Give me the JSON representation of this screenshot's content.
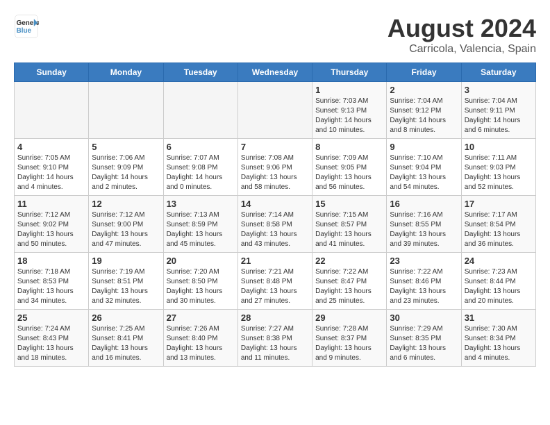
{
  "header": {
    "logo_line1": "General",
    "logo_line2": "Blue",
    "title": "August 2024",
    "subtitle": "Carricola, Valencia, Spain"
  },
  "weekdays": [
    "Sunday",
    "Monday",
    "Tuesday",
    "Wednesday",
    "Thursday",
    "Friday",
    "Saturday"
  ],
  "weeks": [
    [
      {
        "day": "",
        "info": ""
      },
      {
        "day": "",
        "info": ""
      },
      {
        "day": "",
        "info": ""
      },
      {
        "day": "",
        "info": ""
      },
      {
        "day": "1",
        "info": "Sunrise: 7:03 AM\nSunset: 9:13 PM\nDaylight: 14 hours\nand 10 minutes."
      },
      {
        "day": "2",
        "info": "Sunrise: 7:04 AM\nSunset: 9:12 PM\nDaylight: 14 hours\nand 8 minutes."
      },
      {
        "day": "3",
        "info": "Sunrise: 7:04 AM\nSunset: 9:11 PM\nDaylight: 14 hours\nand 6 minutes."
      }
    ],
    [
      {
        "day": "4",
        "info": "Sunrise: 7:05 AM\nSunset: 9:10 PM\nDaylight: 14 hours\nand 4 minutes."
      },
      {
        "day": "5",
        "info": "Sunrise: 7:06 AM\nSunset: 9:09 PM\nDaylight: 14 hours\nand 2 minutes."
      },
      {
        "day": "6",
        "info": "Sunrise: 7:07 AM\nSunset: 9:08 PM\nDaylight: 14 hours\nand 0 minutes."
      },
      {
        "day": "7",
        "info": "Sunrise: 7:08 AM\nSunset: 9:06 PM\nDaylight: 13 hours\nand 58 minutes."
      },
      {
        "day": "8",
        "info": "Sunrise: 7:09 AM\nSunset: 9:05 PM\nDaylight: 13 hours\nand 56 minutes."
      },
      {
        "day": "9",
        "info": "Sunrise: 7:10 AM\nSunset: 9:04 PM\nDaylight: 13 hours\nand 54 minutes."
      },
      {
        "day": "10",
        "info": "Sunrise: 7:11 AM\nSunset: 9:03 PM\nDaylight: 13 hours\nand 52 minutes."
      }
    ],
    [
      {
        "day": "11",
        "info": "Sunrise: 7:12 AM\nSunset: 9:02 PM\nDaylight: 13 hours\nand 50 minutes."
      },
      {
        "day": "12",
        "info": "Sunrise: 7:12 AM\nSunset: 9:00 PM\nDaylight: 13 hours\nand 47 minutes."
      },
      {
        "day": "13",
        "info": "Sunrise: 7:13 AM\nSunset: 8:59 PM\nDaylight: 13 hours\nand 45 minutes."
      },
      {
        "day": "14",
        "info": "Sunrise: 7:14 AM\nSunset: 8:58 PM\nDaylight: 13 hours\nand 43 minutes."
      },
      {
        "day": "15",
        "info": "Sunrise: 7:15 AM\nSunset: 8:57 PM\nDaylight: 13 hours\nand 41 minutes."
      },
      {
        "day": "16",
        "info": "Sunrise: 7:16 AM\nSunset: 8:55 PM\nDaylight: 13 hours\nand 39 minutes."
      },
      {
        "day": "17",
        "info": "Sunrise: 7:17 AM\nSunset: 8:54 PM\nDaylight: 13 hours\nand 36 minutes."
      }
    ],
    [
      {
        "day": "18",
        "info": "Sunrise: 7:18 AM\nSunset: 8:53 PM\nDaylight: 13 hours\nand 34 minutes."
      },
      {
        "day": "19",
        "info": "Sunrise: 7:19 AM\nSunset: 8:51 PM\nDaylight: 13 hours\nand 32 minutes."
      },
      {
        "day": "20",
        "info": "Sunrise: 7:20 AM\nSunset: 8:50 PM\nDaylight: 13 hours\nand 30 minutes."
      },
      {
        "day": "21",
        "info": "Sunrise: 7:21 AM\nSunset: 8:48 PM\nDaylight: 13 hours\nand 27 minutes."
      },
      {
        "day": "22",
        "info": "Sunrise: 7:22 AM\nSunset: 8:47 PM\nDaylight: 13 hours\nand 25 minutes."
      },
      {
        "day": "23",
        "info": "Sunrise: 7:22 AM\nSunset: 8:46 PM\nDaylight: 13 hours\nand 23 minutes."
      },
      {
        "day": "24",
        "info": "Sunrise: 7:23 AM\nSunset: 8:44 PM\nDaylight: 13 hours\nand 20 minutes."
      }
    ],
    [
      {
        "day": "25",
        "info": "Sunrise: 7:24 AM\nSunset: 8:43 PM\nDaylight: 13 hours\nand 18 minutes."
      },
      {
        "day": "26",
        "info": "Sunrise: 7:25 AM\nSunset: 8:41 PM\nDaylight: 13 hours\nand 16 minutes."
      },
      {
        "day": "27",
        "info": "Sunrise: 7:26 AM\nSunset: 8:40 PM\nDaylight: 13 hours\nand 13 minutes."
      },
      {
        "day": "28",
        "info": "Sunrise: 7:27 AM\nSunset: 8:38 PM\nDaylight: 13 hours\nand 11 minutes."
      },
      {
        "day": "29",
        "info": "Sunrise: 7:28 AM\nSunset: 8:37 PM\nDaylight: 13 hours\nand 9 minutes."
      },
      {
        "day": "30",
        "info": "Sunrise: 7:29 AM\nSunset: 8:35 PM\nDaylight: 13 hours\nand 6 minutes."
      },
      {
        "day": "31",
        "info": "Sunrise: 7:30 AM\nSunset: 8:34 PM\nDaylight: 13 hours\nand 4 minutes."
      }
    ]
  ]
}
